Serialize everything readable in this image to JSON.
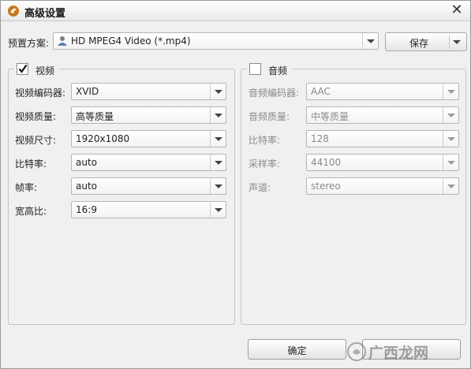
{
  "window": {
    "title": "高级设置",
    "close_glyph": "✕"
  },
  "preset": {
    "label": "预置方案:",
    "value": "HD MPEG4 Video (*.mp4)"
  },
  "save_button": {
    "label": "保存"
  },
  "video": {
    "title": "视频",
    "checked": true,
    "fields": [
      {
        "label": "视频编码器:",
        "value": "XVID"
      },
      {
        "label": "视频质量:",
        "value": "高等质量"
      },
      {
        "label": "视频尺寸:",
        "value": "1920x1080"
      },
      {
        "label": "比特率:",
        "value": "auto"
      },
      {
        "label": "帧率:",
        "value": "auto"
      },
      {
        "label": "宽高比:",
        "value": "16:9"
      }
    ]
  },
  "audio": {
    "title": "音频",
    "checked": false,
    "fields": [
      {
        "label": "音频编码器:",
        "value": "AAC"
      },
      {
        "label": "音频质量:",
        "value": "中等质量"
      },
      {
        "label": "比特率:",
        "value": "128"
      },
      {
        "label": "采样率:",
        "value": "44100"
      },
      {
        "label": "声道:",
        "value": "stereo"
      }
    ]
  },
  "buttons": {
    "ok": "确定"
  },
  "watermark": {
    "text": "广西龙网"
  },
  "colors": {
    "accent": "#1a1a1a",
    "disabled_text": "#8a8a8a",
    "window_bg": "#f0f0f0"
  }
}
